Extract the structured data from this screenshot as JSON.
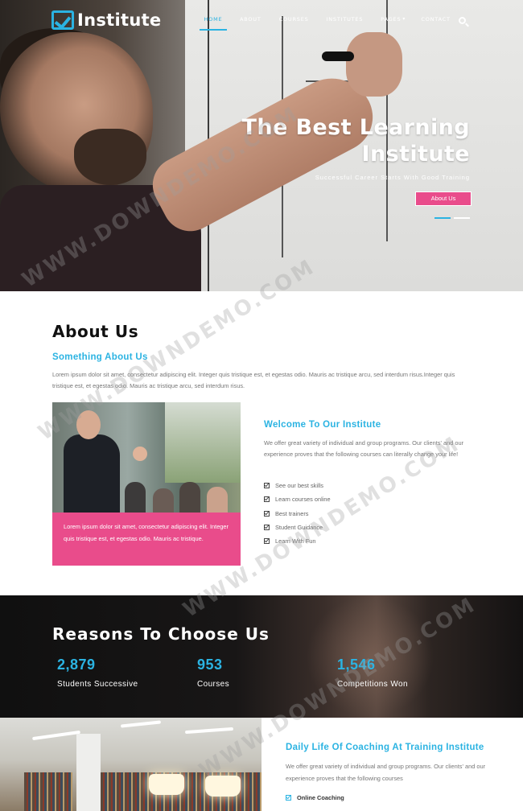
{
  "brand": {
    "name": "Institute",
    "accent": "#2bb3e2",
    "pink": "#e94c8b"
  },
  "nav": {
    "items": [
      "HOME",
      "ABOUT",
      "COURSES",
      "INSTITUTES",
      "PAGES",
      "CONTACT"
    ],
    "active": "HOME",
    "search_icon": "search-icon"
  },
  "hero": {
    "title_line1": "The Best Learning",
    "title_line2": "Institute",
    "subtitle": "Successful Career Starts With Good Training",
    "button": "About Us"
  },
  "about": {
    "title": "About Us",
    "subtitle": "Something About Us",
    "paragraph": "Lorem ipsum dolor sit amet, consectetur adipiscing elit. Integer quis tristique est, et egestas odio. Mauris ac tristique arcu, sed interdum risus.Integer quis tristique est, et egestas odio. Mauris ac tristique arcu, sed interdum risus.",
    "pink_box": "Lorem ipsum dolor sit amet, consectetur adipiscing elit. Integer quis tristique est, et egestas odio. Mauris ac tristique.",
    "welcome_title": "Welcome To Our Institute",
    "welcome_text": "We offer great variety of individual and group programs. Our clients' and our experience proves that the following courses can literally change your life!",
    "checklist": [
      "See our best skills",
      "Learn courses online",
      "Best trainers",
      "Student Guidance",
      "Learn With Fun"
    ]
  },
  "reasons": {
    "title": "Reasons To Choose Us",
    "stats": [
      {
        "number": "2,879",
        "label": "Students Successive"
      },
      {
        "number": "953",
        "label": "Courses"
      },
      {
        "number": "1,546",
        "label": "Competitions Won"
      }
    ]
  },
  "daily": {
    "title": "Daily Life Of Coaching At Training Institute",
    "text": "We offer great variety of individual and group programs. Our clients' and our experience proves that the following courses",
    "list": [
      "Online Coaching"
    ]
  },
  "watermark": "WWW.DOWNDEMO.COM"
}
